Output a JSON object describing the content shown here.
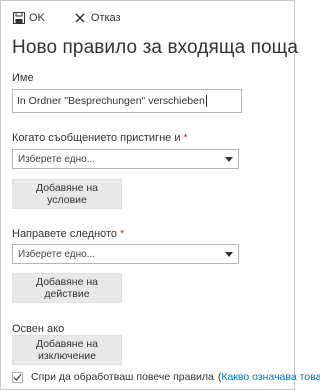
{
  "toolbar": {
    "ok_label": "OK",
    "ok_icon": "save-icon",
    "cancel_label": "Отказ",
    "cancel_icon": "close-icon"
  },
  "title": "Ново правило за входяща поща",
  "name_field": {
    "label": "Име",
    "value": "In Ordner \"Besprechungen\" verschieben"
  },
  "condition": {
    "label": "Когато съобщението пристигне и",
    "required_mark": "*",
    "select_value": "Изберете едно...",
    "add_button": "Добавяне на условие"
  },
  "action": {
    "label": "Направете следното",
    "required_mark": "*",
    "select_value": "Изберете едно...",
    "add_button": "Добавяне на действие"
  },
  "exception": {
    "label": "Освен ако",
    "add_button": "Добавяне на изключение"
  },
  "stop_processing": {
    "label": "Спри да обработваш повече правила",
    "checked": true,
    "paren_open": "(",
    "help_link": "Какво означава това?",
    "paren_close": ")"
  },
  "colors": {
    "link": "#0072c6",
    "required": "#c0392b",
    "button_bg": "#e8e8e8"
  }
}
